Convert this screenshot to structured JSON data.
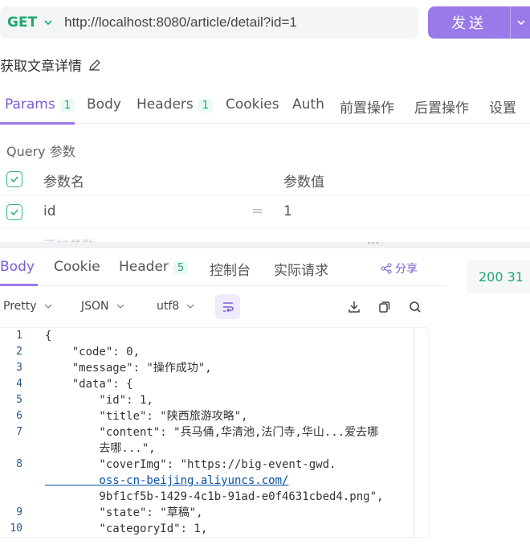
{
  "request": {
    "method": "GET",
    "url": "http://localhost:8080/article/detail?id=1",
    "send_label": "发送",
    "title": "获取文章详情"
  },
  "req_tabs": [
    {
      "label": "Params",
      "badge": "1"
    },
    {
      "label": "Body",
      "badge": ""
    },
    {
      "label": "Headers",
      "badge": "1"
    },
    {
      "label": "Cookies",
      "badge": ""
    },
    {
      "label": "Auth",
      "badge": ""
    },
    {
      "label": "前置操作",
      "badge": ""
    },
    {
      "label": "后置操作",
      "badge": ""
    },
    {
      "label": "设置",
      "badge": ""
    }
  ],
  "params": {
    "section_label": "Query 参数",
    "col_name": "参数名",
    "col_value": "参数值",
    "rows": [
      {
        "name": "id",
        "value": "1"
      }
    ],
    "add_placeholder": "添加参数",
    "split_dots": "···"
  },
  "response": {
    "tabs": [
      {
        "label": "Body",
        "badge": ""
      },
      {
        "label": "Cookie",
        "badge": ""
      },
      {
        "label": "Header",
        "badge": "5"
      },
      {
        "label": "控制台",
        "badge": ""
      },
      {
        "label": "实际请求",
        "badge": ""
      }
    ],
    "share_label": "分享",
    "status_text": "200  31",
    "toolbar": {
      "format": "Pretty",
      "lang": "JSON",
      "encoding": "utf8"
    }
  },
  "code_lines": [
    {
      "no": "1",
      "text": "{"
    },
    {
      "no": "2",
      "text": "    \"code\": 0,"
    },
    {
      "no": "3",
      "text": "    \"message\": \"操作成功\","
    },
    {
      "no": "4",
      "text": "    \"data\": {"
    },
    {
      "no": "5",
      "text": "        \"id\": 1,"
    },
    {
      "no": "6",
      "text": "        \"title\": \"陕西旅游攻略\","
    },
    {
      "no": "7",
      "text": "        \"content\": \"兵马俑,华清池,法门寺,华山...爱去哪"
    },
    {
      "no": "",
      "text": "        去哪...\","
    },
    {
      "no": "8",
      "text": "        \"coverImg\": \"https://big-event-gwd."
    },
    {
      "no": "",
      "text": "        oss-cn-beijing.aliyuncs.com/"
    },
    {
      "no": "",
      "text": "        9bf1cf5b-1429-4c1b-91ad-e0f4631cbed4.png\","
    },
    {
      "no": "9",
      "text": "        \"state\": \"草稿\","
    },
    {
      "no": "10",
      "text": "        \"categoryId\": 1,"
    }
  ]
}
